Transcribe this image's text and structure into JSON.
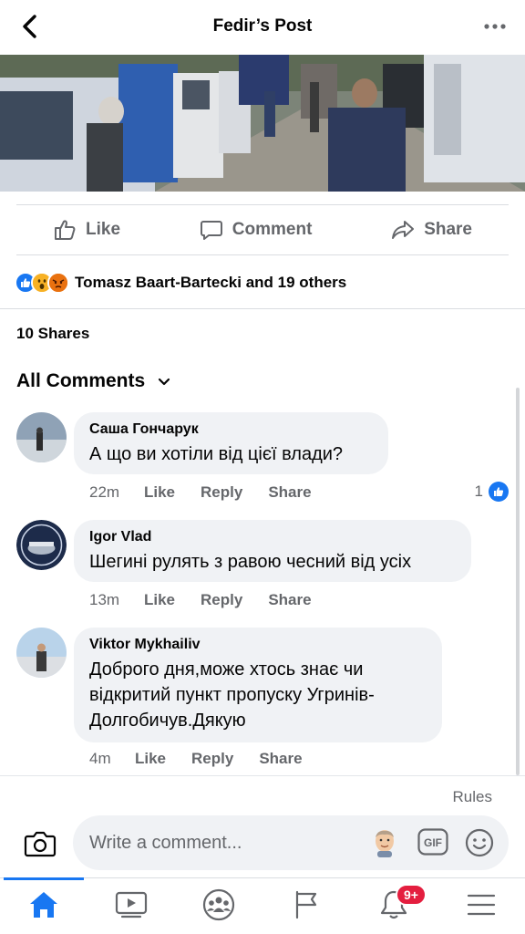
{
  "header": {
    "title": "Fedir’s Post"
  },
  "actions": {
    "like": "Like",
    "comment": "Comment",
    "share": "Share"
  },
  "reactions": {
    "names": "Tomasz Baart-Bartecki and 19 others"
  },
  "shares": {
    "label": "10 Shares"
  },
  "comments_header": {
    "label": "All Comments"
  },
  "comments": [
    {
      "author": "Саша Гончарук",
      "text": "А що ви хотіли від цієї влади?",
      "time": "22m",
      "like": "Like",
      "reply": "Reply",
      "share": "Share",
      "likes": "1"
    },
    {
      "author": "Igor  Vlad",
      "text": "Шегині рулять з равою чесний від усіх",
      "time": "13m",
      "like": "Like",
      "reply": "Reply",
      "share": "Share"
    },
    {
      "author": "Viktor Mykhailiv",
      "text_lines": [
        "Доброго дня,може хтось знає чи",
        "відкритий пункт пропуску Угринів-",
        "Долгобичув.Дякую"
      ],
      "time": "4m",
      "like": "Like",
      "reply": "Reply",
      "share": "Share"
    }
  ],
  "rules": {
    "label": "Rules"
  },
  "composer": {
    "placeholder": "Write a comment...",
    "gif": "GIF"
  },
  "tabbar": {
    "notifications_badge": "9+",
    "active": "home"
  },
  "colors": {
    "accent": "#1877f2",
    "badge": "#e41e3f",
    "secondary_text": "#65676b",
    "bubble": "#f0f2f5"
  }
}
